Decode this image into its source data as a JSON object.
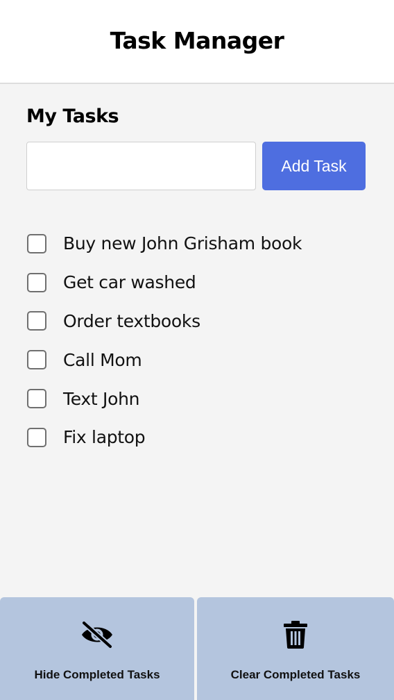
{
  "header": {
    "title": "Task Manager"
  },
  "main": {
    "section_title": "My Tasks",
    "new_task": {
      "value": "",
      "placeholder": ""
    },
    "add_button_label": "Add Task",
    "tasks": [
      {
        "label": "Buy new John Grisham book",
        "checked": false
      },
      {
        "label": "Get car washed",
        "checked": false
      },
      {
        "label": "Order textbooks",
        "checked": false
      },
      {
        "label": "Call Mom",
        "checked": false
      },
      {
        "label": "Text John",
        "checked": false
      },
      {
        "label": "Fix laptop",
        "checked": false
      }
    ]
  },
  "footer": {
    "hide_label": "Hide Completed Tasks",
    "hide_icon": "eye-slash-icon",
    "clear_label": "Clear Completed Tasks",
    "clear_icon": "trash-icon"
  },
  "colors": {
    "accent": "#4e6ee0",
    "footer_bg": "#b4c5de",
    "page_bg": "#f4f4f4",
    "header_bg": "#ffffff"
  }
}
